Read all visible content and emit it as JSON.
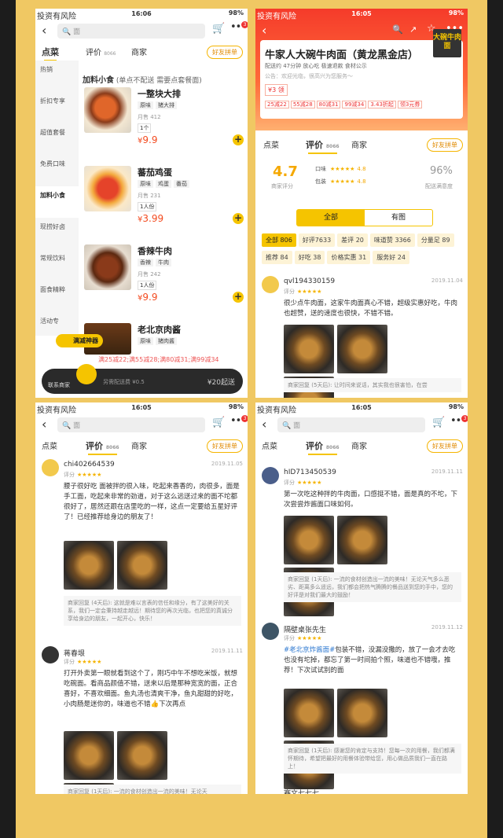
{
  "status": {
    "risk": "投资有风险",
    "battery": "98%"
  },
  "p1": {
    "time": "16:06",
    "search_placeholder": "面",
    "tabs": {
      "order": "点菜",
      "review": "评价",
      "review_count": "8066",
      "merchant": "商家",
      "group": "好友拼单"
    },
    "categories": [
      "热销",
      "折扣专享",
      "超值套餐",
      "免费口味",
      "加料小食",
      "现捞好卤",
      "常规饮料",
      "面食精粹",
      "活动专"
    ],
    "section": {
      "title": "加料小食",
      "note": "(单点不配送  需要点套餐面)"
    },
    "items": [
      {
        "name": "一整块大排",
        "tags": [
          "原味",
          "猪大排"
        ],
        "sold": "月售 412",
        "qty": "1个",
        "price": "9.9"
      },
      {
        "name": "蕃茄鸡蛋",
        "tags": [
          "原味",
          "鸡蛋",
          "番茄"
        ],
        "sold": "月售 231",
        "qty": "1人份",
        "price": "3.99"
      },
      {
        "name": "香辣牛肉",
        "tags": [
          "香辣",
          "牛肉"
        ],
        "sold": "月售 242",
        "qty": "1人份",
        "price": "9.9"
      },
      {
        "name": "老北京肉酱",
        "tags": [
          "原味",
          "猪肉酱"
        ],
        "sold": "",
        "qty": "",
        "price": ""
      }
    ],
    "badge": "满减神器",
    "promo": "满25减22;满55减28;满80减31;满99减34",
    "cart": {
      "contact": "联系商家",
      "fee": "另需配送费 ¥0.5",
      "go": "¥20起送"
    }
  },
  "p2": {
    "time": "16:05",
    "shop_name": "牛家人大碗牛肉面（黄龙黑金店）",
    "meta": "配送约 47分钟  放心吃  极速退款  食材公示",
    "notice": "公告：欢迎光临，很高兴为您服务～",
    "logo": "大碗牛肉面",
    "coupon": "¥3  领",
    "offers": [
      "25减22",
      "55减28",
      "80减31",
      "99减34",
      "3.43折起",
      "领3元券"
    ],
    "tabs": {
      "order": "点菜",
      "review": "评价",
      "review_count": "8066",
      "merchant": "商家",
      "group": "好友拼单"
    },
    "score": "4.7",
    "score_label": "商家评分",
    "taste_label": "口味",
    "taste": "4.8",
    "pack_label": "包装",
    "pack": "4.8",
    "satisfaction": "96%",
    "satisfaction_label": "配送满意度",
    "seg_all": "全部",
    "seg_pic": "有图",
    "chips": [
      "全部 806",
      "好评7633",
      "差评 20",
      "味道赞 3366",
      "分量足 89",
      "推荐 84",
      "好吃 38",
      "价格实惠 31",
      "服务好 24"
    ],
    "review": {
      "user": "qvl194330159",
      "date": "2019.11.04",
      "label": "评分",
      "stars": "★★★★★",
      "text": "很少点牛肉面，这家牛肉面真心不错，超级实惠好吃，牛肉也超赞，送的速度也很快，不错不错。",
      "reply": "商家回复 (5天后): 让时间来说话，其实我也很害怕，在尝"
    }
  },
  "p3": {
    "time": "16:05",
    "r1": {
      "user": "chi402664539",
      "date": "2019.11.05",
      "label": "评分",
      "stars": "★★★★★",
      "text": "腰子很好吃 面被拌的很入味，吃起来香香的，肉很多，面是手工面，吃起来非常的劲道，对于这么远送过来的面不坨都很好了，居然还跟在店里吃的一样，这点一定要给五星好评了！已经推荐给身边的朋友了！",
      "reply": "商家回复 (4天后): 这就是难以言表的信任和缘分，有了这美好的关系，我们一定会秉持越走越远！期待您的再次光临，也把您的真诚分享给身边的朋友，一起开心，快乐！"
    },
    "r2": {
      "user": "蒋春垠",
      "date": "2019.11.11",
      "label": "评分",
      "stars": "★★★★★",
      "text": "打开外卖第一眼就看到这个了，刚巧中午不想吃米饭，就想吃碗面。看商品颜值不错，送来以后是那种宽宽的面，正合喜好，不喜欢细面。鱼丸汤也清爽干净，鱼丸甜甜的好吃，小肉肠是迷你的，味道也不错👍下次再点",
      "reply": "商家回复 (1天后): 一流的食材创造出一流的美味！无论天"
    }
  },
  "p4": {
    "time": "16:05",
    "r1": {
      "user": "hID713450539",
      "date": "2019.11.11",
      "label": "评分",
      "stars": "★★★★★",
      "text": "第一次吃这种拌的牛肉面，口感挺不错，面是真的不坨，下次尝尝炸酱面口味如何。",
      "reply": "商家回复 (1天后): 一流的食材创造出一流的美味！无论天气多么恶劣、距离多么遥远，我们都会把热气腾腾的餐品送到您的手中，您的好评是对我们最大的鼓励！"
    },
    "r2": {
      "user": "隔壁桌张先生",
      "date": "2019.11.12",
      "label": "评分",
      "stars": "★★★★★",
      "hashtag": "#老北京炸酱面#",
      "text": "包装不错，没漏没撒的，放了一会才去吃也没有坨掉，都忘了第一时间拍个照，味道也不错哦，推荐！下次试试别的面",
      "reply": "商家回复 (1天后): 感谢您的肯定与支持！您每一次的用餐，我们都满怀期待，希望把最好的用餐体验带给您，用心做品质我们一直在路上！"
    },
    "r3_user": "赛文七七七"
  }
}
